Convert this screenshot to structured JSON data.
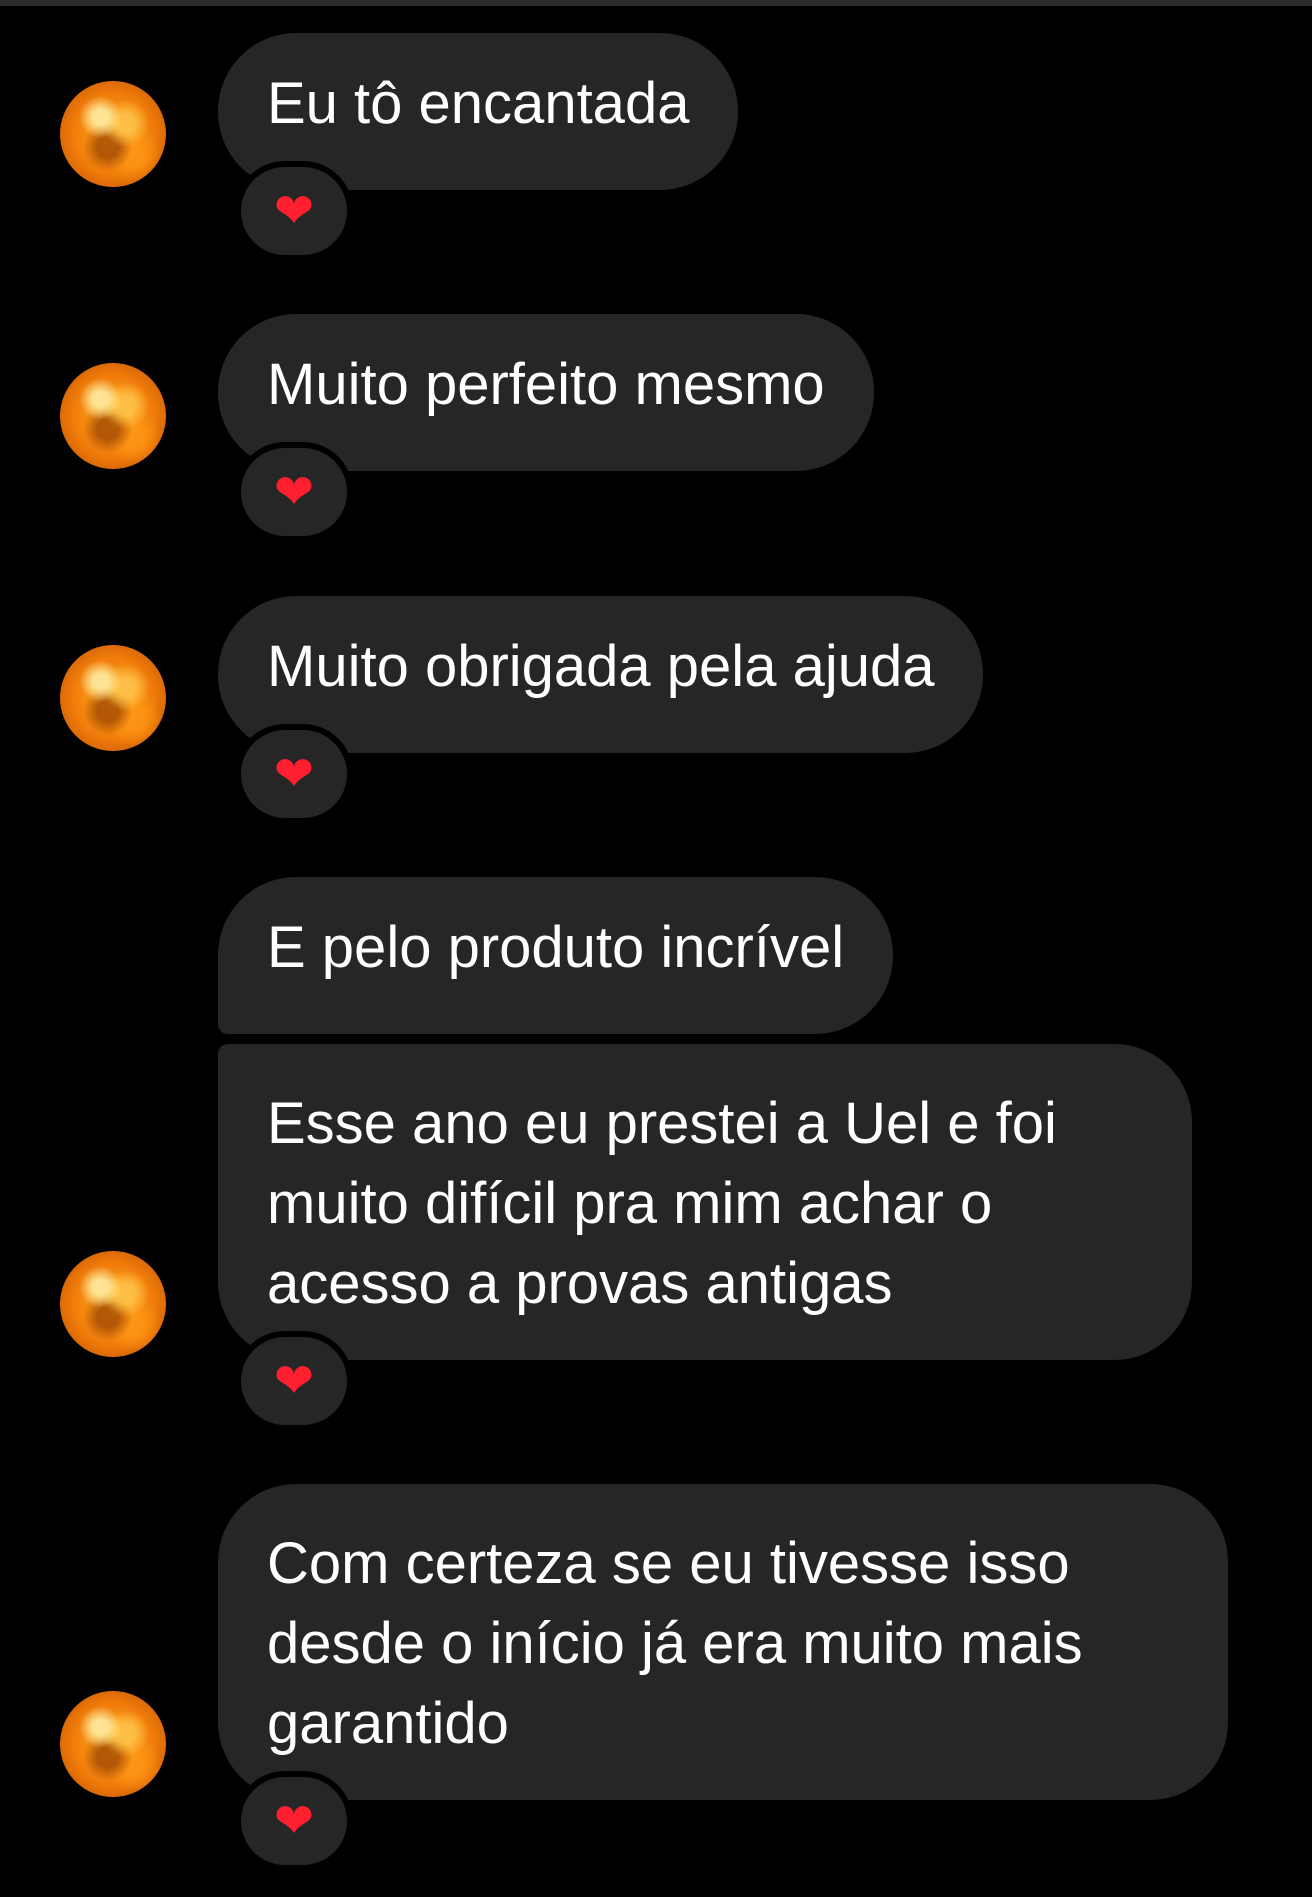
{
  "colors": {
    "background": "#000000",
    "bubble": "#262626",
    "text": "#ffffff",
    "heart": "#ff1f2e"
  },
  "messages": [
    {
      "text": "Eu tô encantada",
      "reaction": "❤"
    },
    {
      "text": "Muito perfeito mesmo",
      "reaction": "❤"
    },
    {
      "text": "Muito obrigada pela ajuda",
      "reaction": "❤"
    },
    {
      "text": "E pelo produto incrível"
    },
    {
      "lines": [
        "Esse ano eu prestei a Uel e foi",
        "muito difícil pra mim achar o",
        "acesso a provas antigas"
      ],
      "reaction": "❤"
    },
    {
      "lines": [
        "Com certeza se eu tivesse isso",
        "desde o início já era muito mais",
        "garantido"
      ],
      "reaction": "❤"
    }
  ],
  "icons": {
    "avatar": "avatar-image",
    "reaction": "heart-icon"
  }
}
